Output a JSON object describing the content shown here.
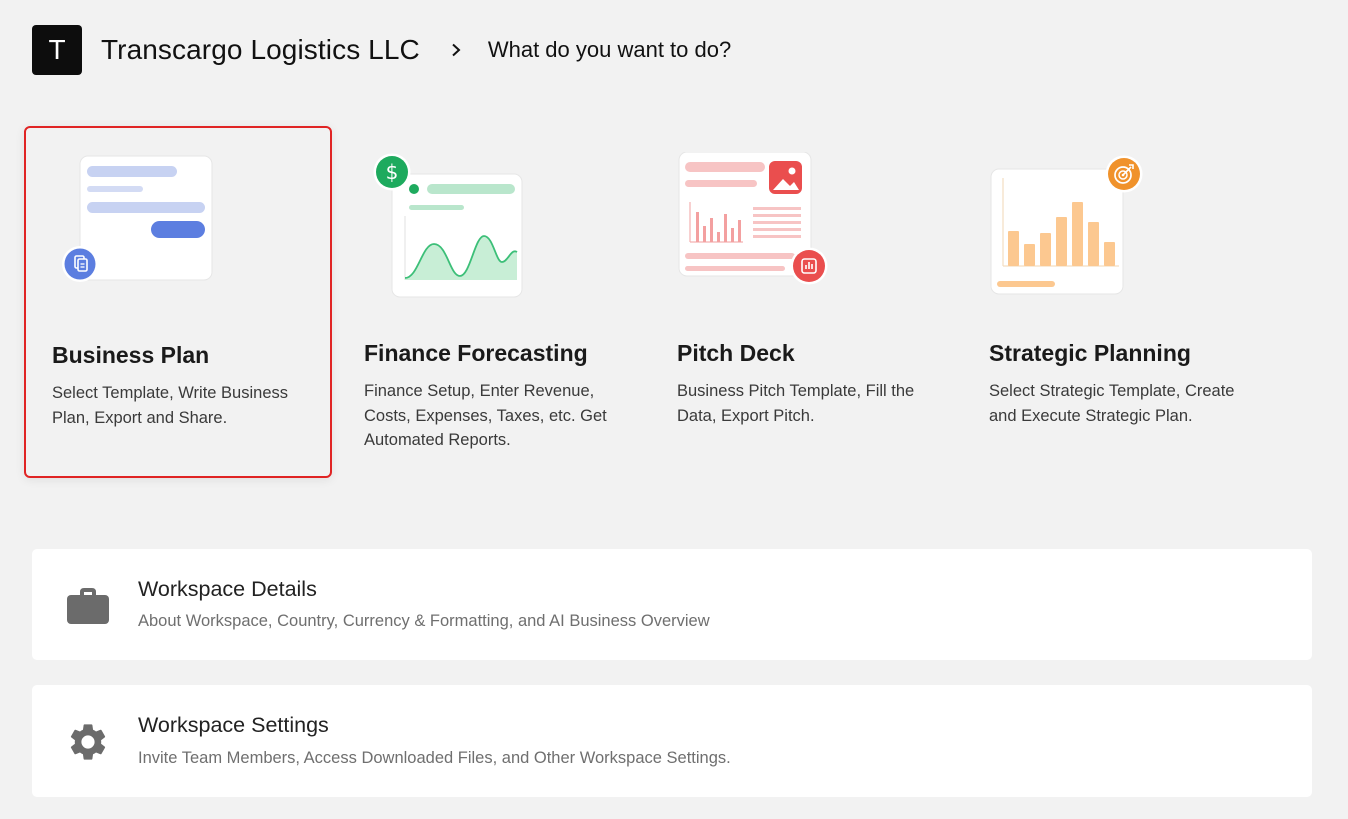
{
  "header": {
    "logo_letter": "T",
    "company": "Transcargo Logistics LLC",
    "question": "What do you want to do?"
  },
  "cards": [
    {
      "title": "Business Plan",
      "description": "Select Template, Write Business Plan, Export and Share.",
      "selected": true,
      "accent": "#5c7ee0"
    },
    {
      "title": "Finance Forecasting",
      "description": "Finance Setup, Enter Revenue, Costs, Expenses, Taxes, etc. Get Automated Reports.",
      "accent": "#1eaa5e"
    },
    {
      "title": "Pitch Deck",
      "description": "Business Pitch Template, Fill the Data, Export Pitch.",
      "accent": "#ea4e4e"
    },
    {
      "title": "Strategic Planning",
      "description": "Select Strategic Template, Create and Execute Strategic Plan.",
      "accent": "#f0922b"
    }
  ],
  "panels": [
    {
      "title": "Workspace Details",
      "subtitle": "About Workspace, Country, Currency & Formatting, and AI Business Overview",
      "icon": "briefcase-icon"
    },
    {
      "title": "Workspace Settings",
      "subtitle": "Invite Team Members, Access Downloaded Files, and Other Workspace Settings.",
      "icon": "gear-icon"
    }
  ],
  "colors": {
    "selection": "#e02424",
    "background": "#f2f2f2"
  }
}
